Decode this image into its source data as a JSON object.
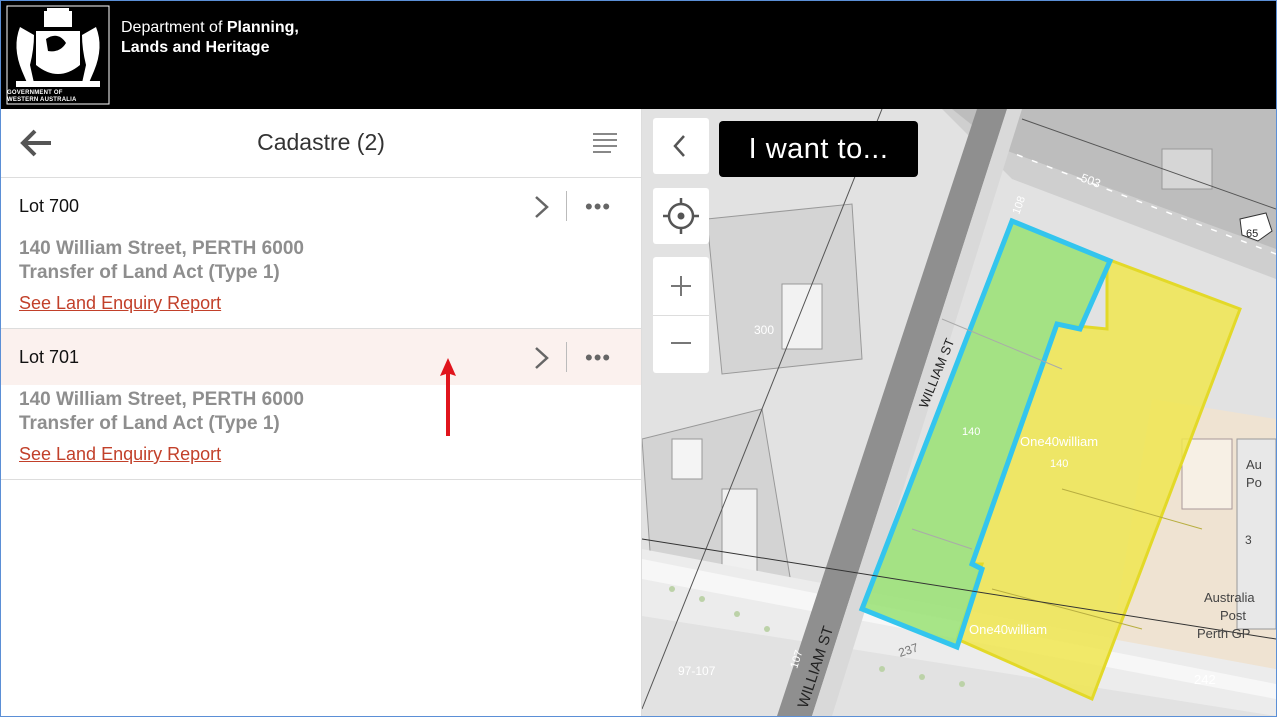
{
  "header": {
    "dept_prefix": "Department of ",
    "dept_bold": "Planning,",
    "dept_line2": "Lands and Heritage",
    "gov_line1": "GOVERNMENT OF",
    "gov_line2": "WESTERN AUSTRALIA"
  },
  "panel": {
    "title": "Cadastre (2)",
    "lots": [
      {
        "title": "Lot 700",
        "address": "140 William Street, PERTH 6000",
        "act": "Transfer of Land Act (Type 1)",
        "link": "See Land Enquiry Report"
      },
      {
        "title": "Lot 701",
        "address": "140 William Street, PERTH 6000",
        "act": "Transfer of Land Act (Type 1)",
        "link": "See Land Enquiry Report"
      }
    ],
    "more_glyph": "•••"
  },
  "map": {
    "i_want_to": "I want to...",
    "labels": {
      "william_st_1": "WILLIAM ST",
      "william_st_2": "WILLIAM ST",
      "one40_1": "One40william",
      "one40_2": "One40william",
      "num_140a": "140",
      "num_140b": "140",
      "num_300": "300",
      "num_237": "237",
      "num_97": "97-107",
      "num_242": "242",
      "num_3": "3",
      "num_65": "65",
      "num_503": "503",
      "num_108": "108",
      "num_107": "107",
      "au": "Au",
      "po": "Po",
      "australia": "Australia",
      "post": "Post",
      "perth_gp": "Perth GP"
    }
  },
  "colors": {
    "accent_link": "#c2402a",
    "lot_highlight_green": "#9de27a",
    "lot_highlight_yellow": "#f0e650",
    "selection_outline": "#33c5ee",
    "header_bg": "#000000"
  }
}
